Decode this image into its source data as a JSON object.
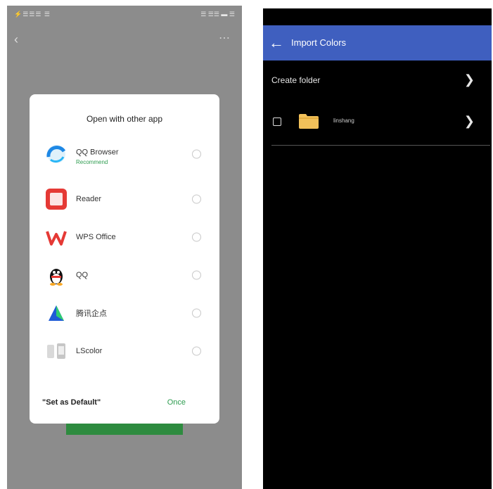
{
  "left_screen": {
    "status_left": "⚡☰☰☰ ☰",
    "status_right": "☰ ☰☰ ▬ ☰",
    "back_icon": "back-icon",
    "more_icon": "more-icon",
    "dialog": {
      "title": "Open with other app",
      "apps": [
        {
          "name": "QQ Browser",
          "subtitle": "Recommend",
          "icon": "qq-browser-icon"
        },
        {
          "name": "Reader",
          "icon": "reader-icon"
        },
        {
          "name": "WPS Office",
          "icon": "wps-office-icon"
        },
        {
          "name": "QQ",
          "icon": "qq-icon"
        },
        {
          "name": "腾讯企点",
          "icon": "qidian-icon"
        },
        {
          "name": "LScolor",
          "icon": "lscolor-icon"
        }
      ],
      "set_default": "\"Set as Default\"",
      "once": "Once"
    }
  },
  "right_screen": {
    "appbar": {
      "back_glyph": "←",
      "title": "Import Colors"
    },
    "create_folder": "Create folder",
    "folder_item": {
      "name": "linshang"
    },
    "chevron": "❯",
    "colors": {
      "appbar": "#3f5fbf",
      "background": "#000000",
      "folder": "#f2c15a"
    }
  }
}
